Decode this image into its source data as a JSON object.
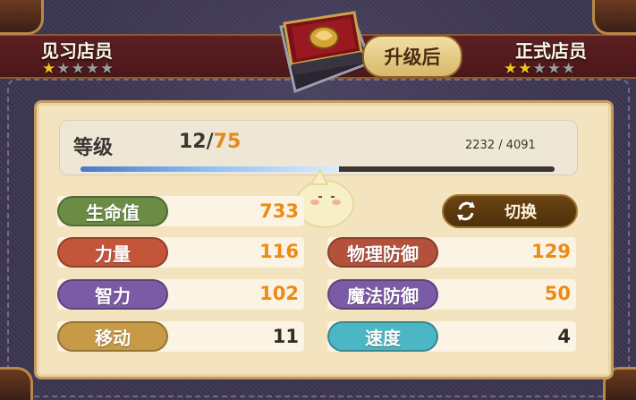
{
  "header": {
    "current_rank": {
      "label": "见习店员",
      "stars_total": 5,
      "stars_filled": 1
    },
    "next_rank": {
      "label": "正式店员",
      "stars_total": 5,
      "stars_filled": 2
    },
    "upgrade_label": "升级后",
    "book_icon": "recipe-book-icon"
  },
  "level": {
    "label": "等级",
    "current": "12",
    "separator": "/",
    "max": "75",
    "exp_text": "2232 / 4091",
    "exp_fraction": 0.5456
  },
  "switch_button": {
    "label": "切换",
    "icon": "refresh-arrows-icon"
  },
  "stats": [
    {
      "label": "生命值",
      "value": "733",
      "color": "#6b8c45",
      "value_color": "orange"
    },
    {
      "label": "力量",
      "value": "116",
      "color": "#c2553a",
      "value_color": "orange"
    },
    {
      "label": "物理防御",
      "value": "129",
      "color": "#b4513d",
      "value_color": "orange"
    },
    {
      "label": "智力",
      "value": "102",
      "color": "#7b5aa6",
      "value_color": "orange"
    },
    {
      "label": "魔法防御",
      "value": "50",
      "color": "#7b5aa6",
      "value_color": "orange"
    },
    {
      "label": "移动",
      "value": "11",
      "color": "#c79a47",
      "value_color": "dark"
    },
    {
      "label": "速度",
      "value": "4",
      "color": "#4bb6c4",
      "value_color": "dark"
    }
  ],
  "colors": {
    "accent_orange": "#ee8a14",
    "header_red": "#5e1f22",
    "star_gold": "#f3c31f"
  }
}
